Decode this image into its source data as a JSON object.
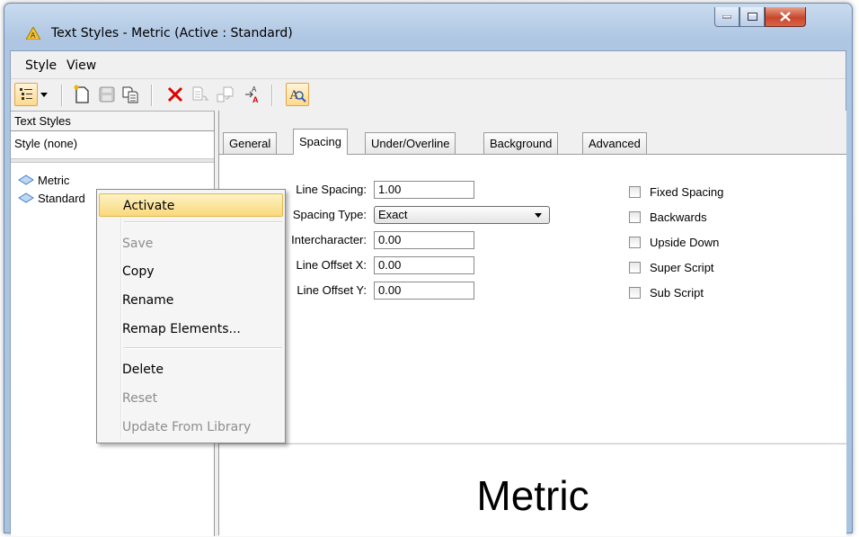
{
  "window": {
    "title": "Text Styles - Metric (Active : Standard)"
  },
  "menu": {
    "style": "Style",
    "view": "View"
  },
  "toolbar": {
    "buttons": [
      "list-view-icon",
      "dropdown-arrow-icon",
      "new-style-icon",
      "save-icon",
      "copy-icon",
      "delete-icon",
      "reset-icon",
      "update-from-library-icon",
      "remap-icon",
      "preview-icon"
    ]
  },
  "left_pane": {
    "header": "Text Styles",
    "style_none": "Style (none)",
    "items": [
      "Metric",
      "Standard"
    ]
  },
  "tabs": [
    "General",
    "Spacing",
    "Under/Overline",
    "Background",
    "Advanced"
  ],
  "active_tab": "Spacing",
  "spacing": {
    "line_spacing": {
      "label": "Line Spacing:",
      "value": "1.00"
    },
    "spacing_type": {
      "label": "Spacing Type:",
      "value": "Exact"
    },
    "intercharacter": {
      "label": "Intercharacter:",
      "value": "0.00"
    },
    "line_offset_x": {
      "label": "Line Offset X:",
      "value": "0.00"
    },
    "line_offset_y": {
      "label": "Line Offset Y:",
      "value": "0.00"
    }
  },
  "checkboxes": [
    "Fixed Spacing",
    "Backwards",
    "Upside Down",
    "Super Script",
    "Sub Script"
  ],
  "preview": {
    "text": "Metric"
  },
  "context_menu": {
    "items": [
      {
        "label": "Activate",
        "state": "highlighted"
      },
      {
        "label": "Save",
        "state": "disabled"
      },
      {
        "label": "Copy",
        "state": "enabled"
      },
      {
        "label": "Rename",
        "state": "enabled"
      },
      {
        "label": "Remap Elements...",
        "state": "enabled"
      },
      {
        "label": "Delete",
        "state": "enabled"
      },
      {
        "label": "Reset",
        "state": "disabled"
      },
      {
        "label": "Update From Library",
        "state": "disabled"
      }
    ]
  },
  "colors": {
    "title_bar": "#aec6e2",
    "close_button": "#c8472b",
    "highlight": "#f9d97a",
    "delete_red": "#e00000"
  }
}
